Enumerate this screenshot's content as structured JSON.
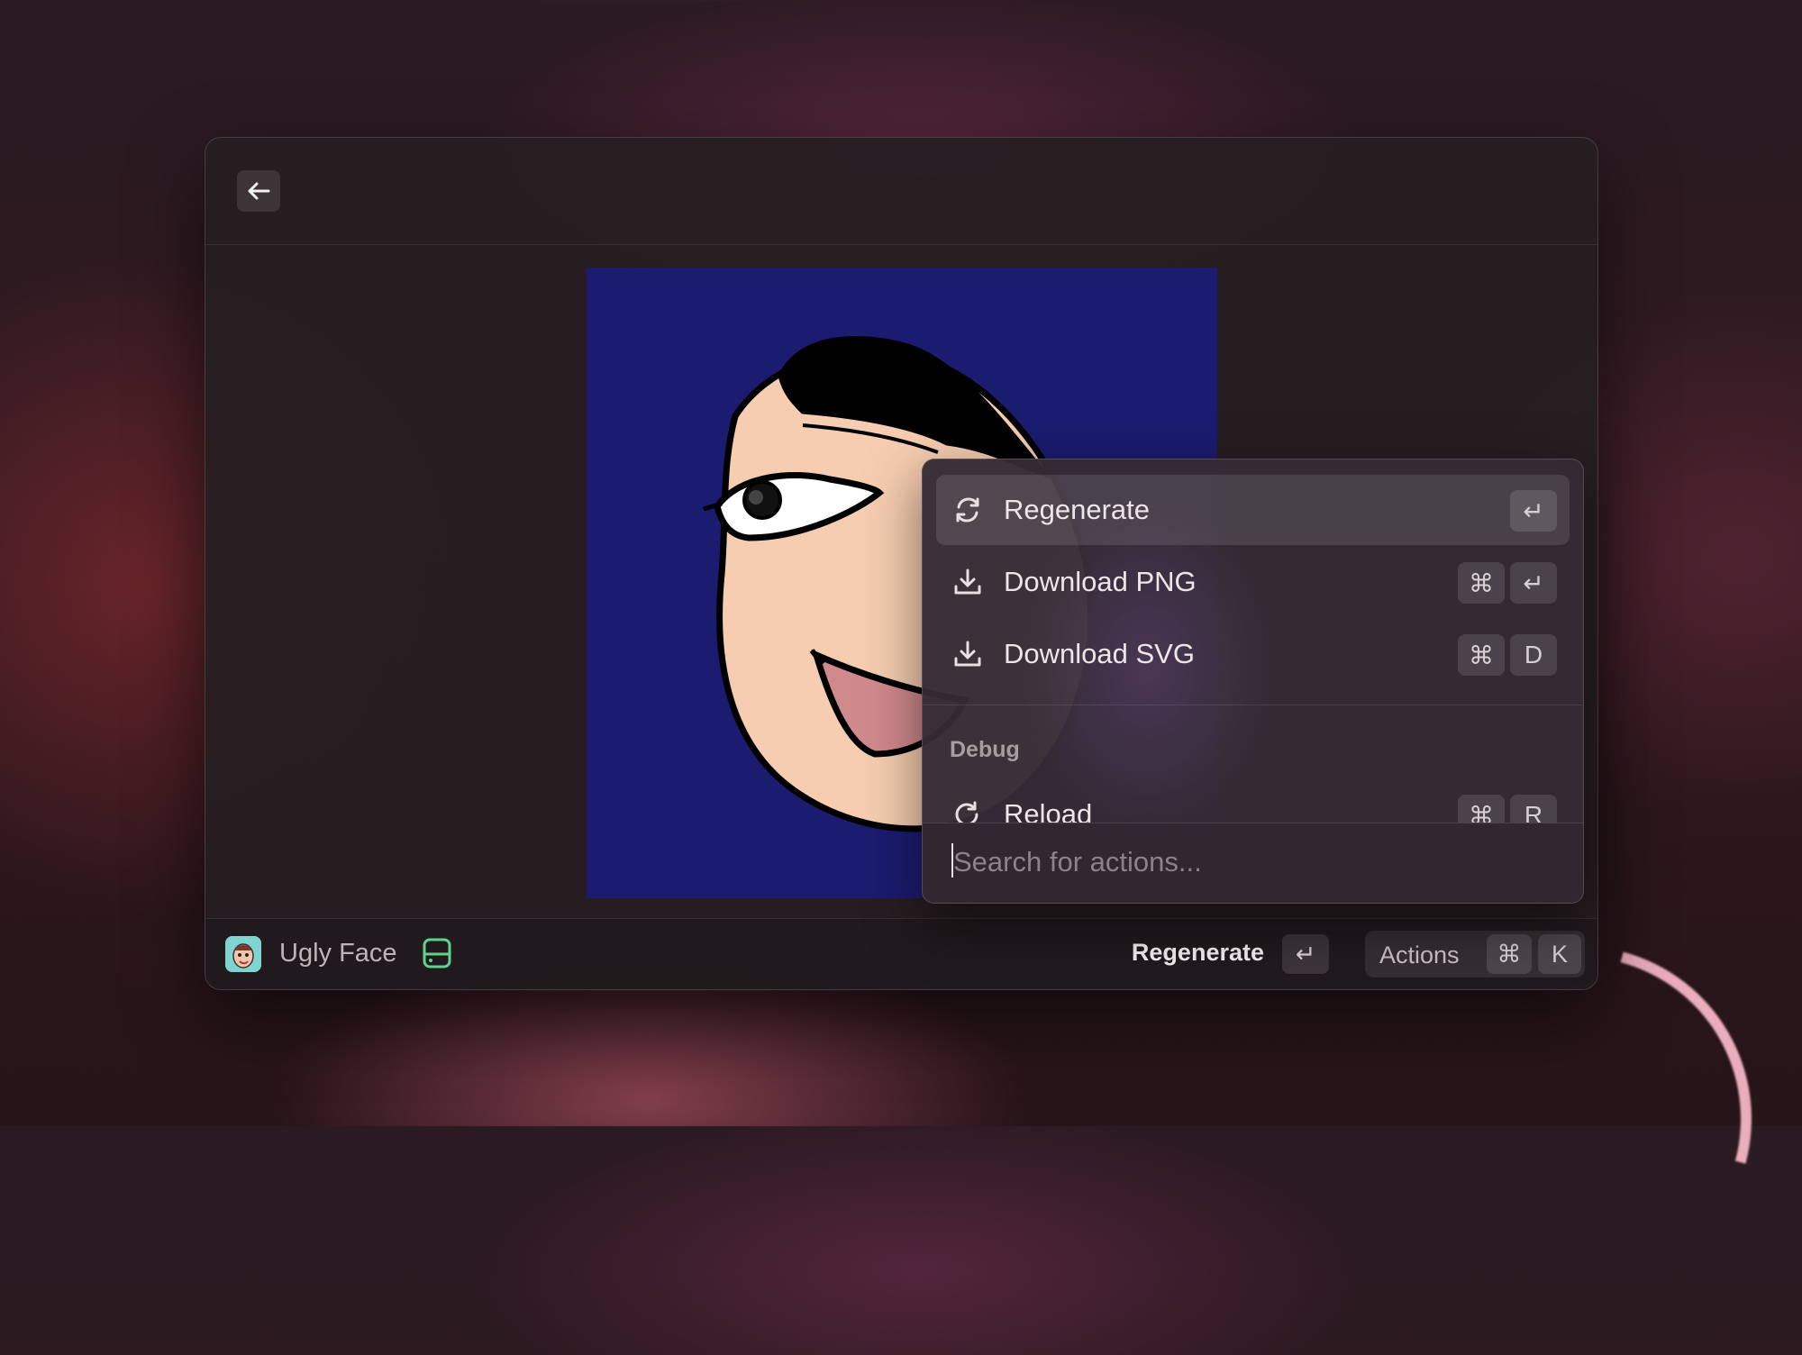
{
  "app": {
    "title": "Ugly Face"
  },
  "footer": {
    "primary_action": "Regenerate",
    "primary_key": "↵",
    "actions_label": "Actions",
    "actions_keys": [
      "⌘",
      "K"
    ]
  },
  "menu": {
    "items": [
      {
        "label": "Regenerate",
        "icon": "refresh-icon",
        "keys": [
          "↵"
        ],
        "selected": true
      },
      {
        "label": "Download PNG",
        "icon": "download-icon",
        "keys": [
          "⌘",
          "↵"
        ],
        "selected": false
      },
      {
        "label": "Download SVG",
        "icon": "download-icon",
        "keys": [
          "⌘",
          "D"
        ],
        "selected": false
      }
    ],
    "section": "Debug",
    "debug_items": [
      {
        "label": "Reload",
        "icon": "reload-icon",
        "keys": [
          "⌘",
          "R"
        ]
      }
    ],
    "search_placeholder": "Search for actions..."
  },
  "colors": {
    "image_background": "#1b1b70",
    "skin": "#f6cdb0",
    "accent_green": "#5fd38a"
  }
}
